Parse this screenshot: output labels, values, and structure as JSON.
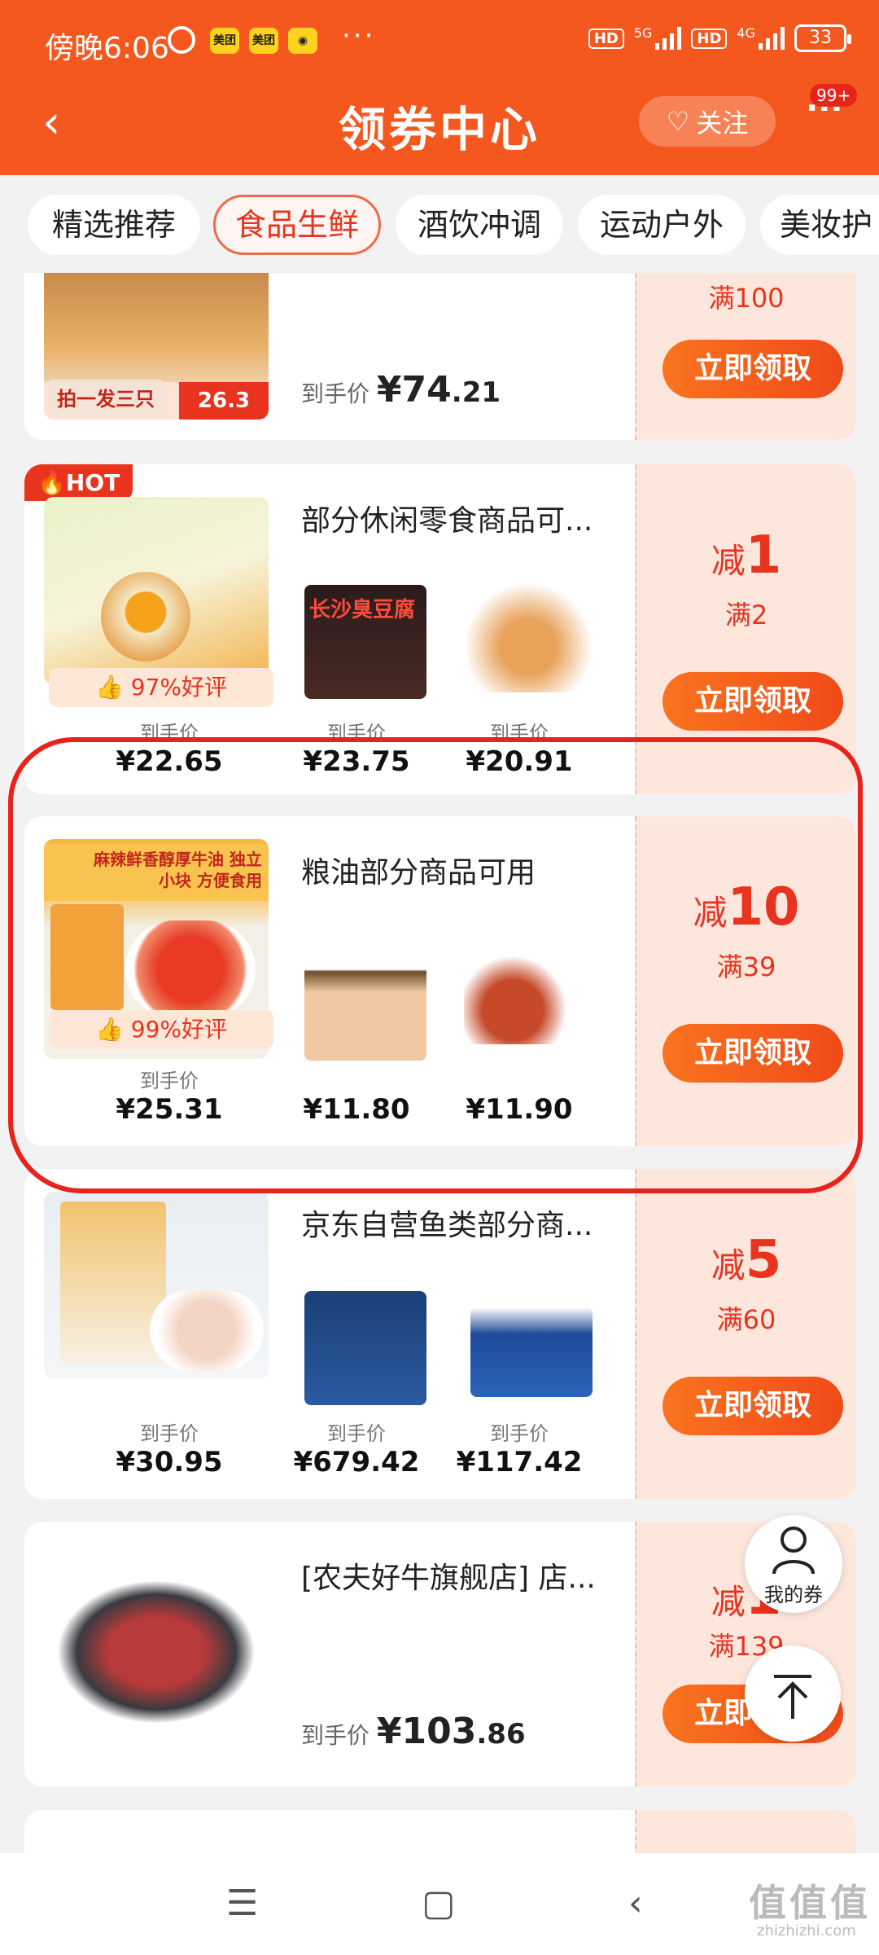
{
  "status": {
    "time": "傍晚6:06",
    "app1": "美团",
    "app2": "美团",
    "dots": "···",
    "hd1": "HD",
    "n5g": "5G",
    "hd2": "HD",
    "n4g": "4G",
    "battery": "33"
  },
  "nav": {
    "title": "领券中心",
    "follow": "关注",
    "badge": "99+"
  },
  "tabs": [
    "精选推荐",
    "食品生鲜",
    "酒饮冲调",
    "运动户外",
    "美妆护"
  ],
  "labels": {
    "price_label": "到手价",
    "claim": "立即领取",
    "reduce": "减",
    "min_prefix": "满",
    "hot": "HOT",
    "my_coupon": "我的券"
  },
  "cards": [
    {
      "min": "满100",
      "price_label": "到手价",
      "price_int": "¥74",
      "price_dec": ".21",
      "promo": "拍一发三只",
      "promo_price": "26.3"
    },
    {
      "name": "部分休闲零食商品可...",
      "reduce": "1",
      "min": "满2",
      "rating": "97%好评",
      "prices": [
        "¥22.65",
        "¥23.75",
        "¥20.91"
      ],
      "thumb1_text": "长沙臭豆腐"
    },
    {
      "name": "粮油部分商品可用",
      "reduce": "10",
      "min": "满39",
      "rating": "99%好评",
      "prices": [
        "¥25.31",
        "¥11.80",
        "¥11.90"
      ],
      "banner": "麻辣鲜香醇厚牛油 独立小块 方便食用"
    },
    {
      "name": "京东自营鱼类部分商...",
      "reduce": "5",
      "min": "满60",
      "prices": [
        "¥30.95",
        "¥679.42",
        "¥117.42"
      ]
    },
    {
      "name": "[农夫好牛旗舰店] 店...",
      "reduce": "1",
      "min": "满139",
      "price_int": "¥103",
      "price_dec": ".86"
    }
  ],
  "colors": {
    "brand": "#f4581e",
    "accent": "#e8331f",
    "coupon_bg": "#fde7dd"
  },
  "watermark": {
    "main": "值值值",
    "sub": "zhizhizhi.com"
  }
}
